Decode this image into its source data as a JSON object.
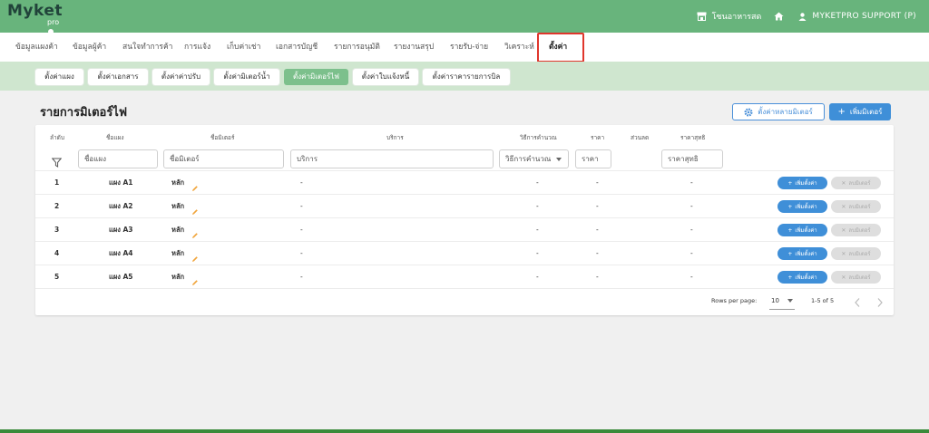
{
  "app": {
    "logo_main": "Myket",
    "logo_sub": "pro",
    "store_name": "โซนอาหารสด",
    "user_name": "MYKETPRO SUPPORT (P)"
  },
  "main_nav": [
    "ข้อมูลแผงค้า",
    "ข้อมูลผู้ค้า",
    "สนใจทำการค้า",
    "การแจ้ง",
    "เก็บค่าเช่า",
    "เอกสารบัญชี",
    "รายการอนุมัติ",
    "รายงานสรุป",
    "รายรับ-จ่าย",
    "วิเคราะห์",
    "ตั้งค่า"
  ],
  "main_nav_active": "ตั้งค่า",
  "sub_nav": [
    "ตั้งค่าแผง",
    "ตั้งค่าเอกสาร",
    "ตั้งค่าค่าปรับ",
    "ตั้งค่ามิเตอร์น้ำ",
    "ตั้งค่ามิเตอร์ไฟ",
    "ตั้งค่าใบแจ้งหนี้",
    "ตั้งค่าราคารายการบิล"
  ],
  "sub_nav_active": "ตั้งค่ามิเตอร์ไฟ",
  "page": {
    "title": "รายการมิเตอร์ไฟ",
    "multi_setting_label": "ตั้งค่าหลายมิเตอร์",
    "add_meter_label": "เพิ่มมิเตอร์"
  },
  "table": {
    "columns": [
      "ลำดับ",
      "ชื่อแผง",
      "ชื่อมิเตอร์",
      "บริการ",
      "วิธีการคำนวณ",
      "ราคา",
      "ส่วนลด",
      "ราคาสุทธิ"
    ],
    "filters": {
      "stall_placeholder": "ชื่อแผง",
      "meter_placeholder": "ชื่อมิเตอร์",
      "service_placeholder": "บริการ",
      "method_placeholder": "วิธีการคำนวณ",
      "price_placeholder": "ราคา",
      "net_placeholder": "ราคาสุทธิ"
    },
    "rows": [
      {
        "no": "1",
        "stall": "แผง A1",
        "meter": "หลัก",
        "service": "-",
        "method": "-",
        "price": "-",
        "net": "-"
      },
      {
        "no": "2",
        "stall": "แผง A2",
        "meter": "หลัก",
        "service": "-",
        "method": "-",
        "price": "-",
        "net": "-"
      },
      {
        "no": "3",
        "stall": "แผง A3",
        "meter": "หลัก",
        "service": "-",
        "method": "-",
        "price": "-",
        "net": "-"
      },
      {
        "no": "4",
        "stall": "แผง A4",
        "meter": "หลัก",
        "service": "-",
        "method": "-",
        "price": "-",
        "net": "-"
      },
      {
        "no": "5",
        "stall": "แผง A5",
        "meter": "หลัก",
        "service": "-",
        "method": "-",
        "price": "-",
        "net": "-"
      }
    ],
    "row_add_label": "เพิ่มตั้งค่า",
    "row_delete_label": "ลบมิเตอร์"
  },
  "pagination": {
    "rows_per_page_label": "Rows per page:",
    "rows_per_page_value": "10",
    "range_label": "1-5 of 5"
  },
  "colors": {
    "brand_green": "#68b47c",
    "subnav_bg": "#cfe6cf",
    "primary_blue": "#3f8fd8",
    "highlight_red": "#e0362c"
  }
}
